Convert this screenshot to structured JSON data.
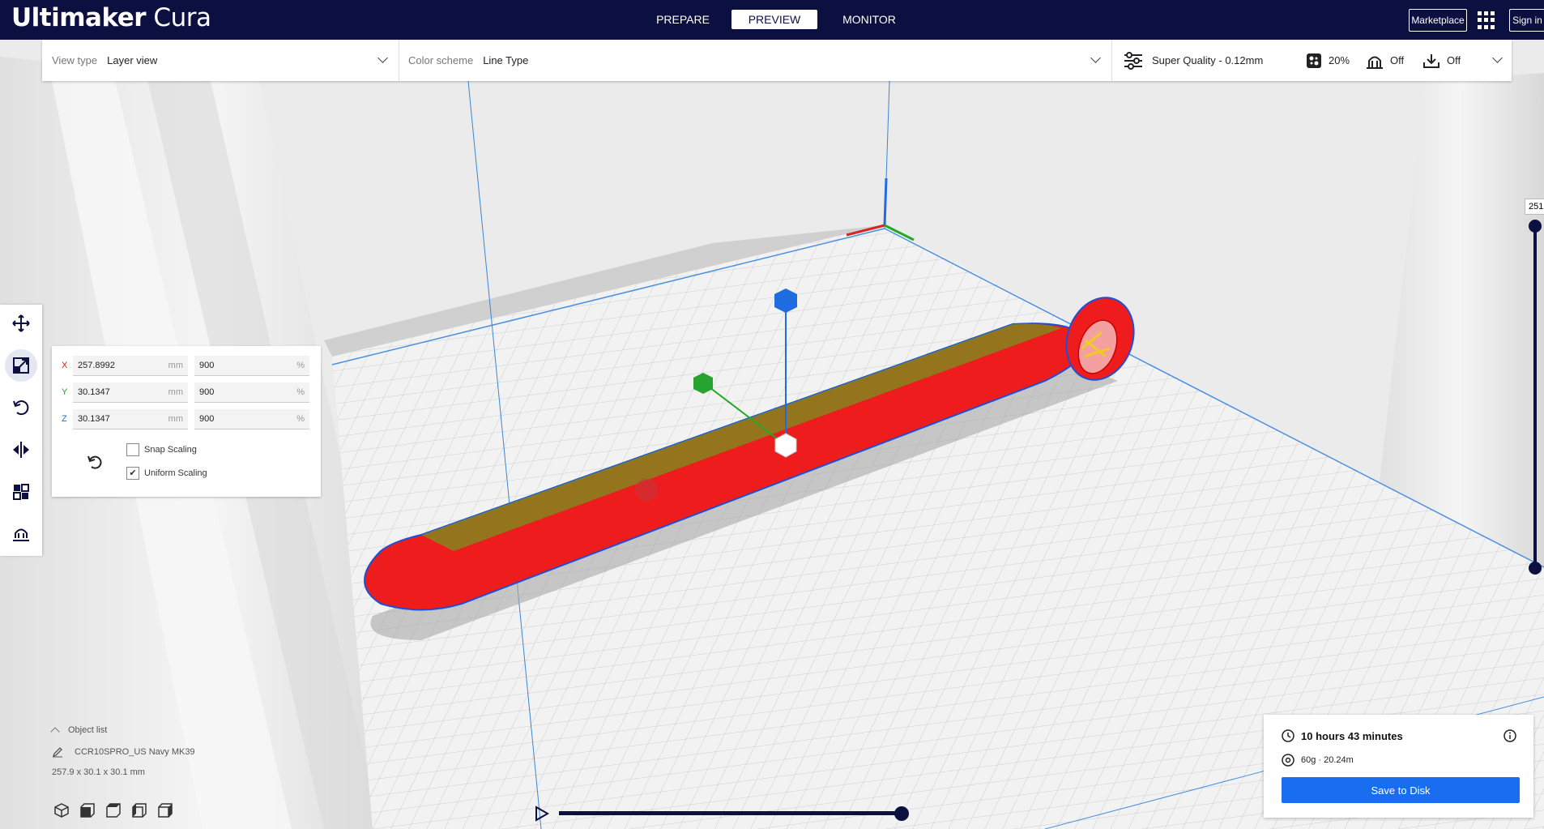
{
  "app": {
    "logo_bold": "Ultimaker",
    "logo_light": "Cura"
  },
  "stages": {
    "prepare": "PREPARE",
    "preview": "PREVIEW",
    "monitor": "MONITOR"
  },
  "header": {
    "marketplace": "Marketplace",
    "sign_in": "Sign in"
  },
  "view_settings": {
    "view_type_label": "View type",
    "view_type_value": "Layer view",
    "color_scheme_label": "Color scheme",
    "color_scheme_value": "Line Type"
  },
  "print_setup": {
    "profile": "Super Quality - 0.12mm",
    "infill": "20%",
    "support": "Off",
    "adhesion": "Off"
  },
  "scale_tool": {
    "rows": [
      {
        "axis": "X",
        "size": "257.8992",
        "size_unit": "mm",
        "percent": "900",
        "percent_unit": "%"
      },
      {
        "axis": "Y",
        "size": "30.1347",
        "size_unit": "mm",
        "percent": "900",
        "percent_unit": "%"
      },
      {
        "axis": "Z",
        "size": "30.1347",
        "size_unit": "mm",
        "percent": "900",
        "percent_unit": "%"
      }
    ],
    "snap_scaling": "Snap Scaling",
    "snap_scaling_checked": false,
    "uniform_scaling": "Uniform Scaling",
    "uniform_scaling_checked": true,
    "check_mark": "✔"
  },
  "object_list": {
    "header": "Object list",
    "object_name": "CCR10SPRO_US Navy MK39",
    "dimensions": "257.9 x 30.1 x 30.1 mm"
  },
  "print_info": {
    "time": "10 hours 43 minutes",
    "material": "60g · 20.24m",
    "save_button": "Save to Disk"
  },
  "layer_slider": {
    "current_layer": "251"
  },
  "colors": {
    "header_bg": "#0b1041",
    "accent": "#196ef0",
    "model": "#ee1c1c"
  }
}
